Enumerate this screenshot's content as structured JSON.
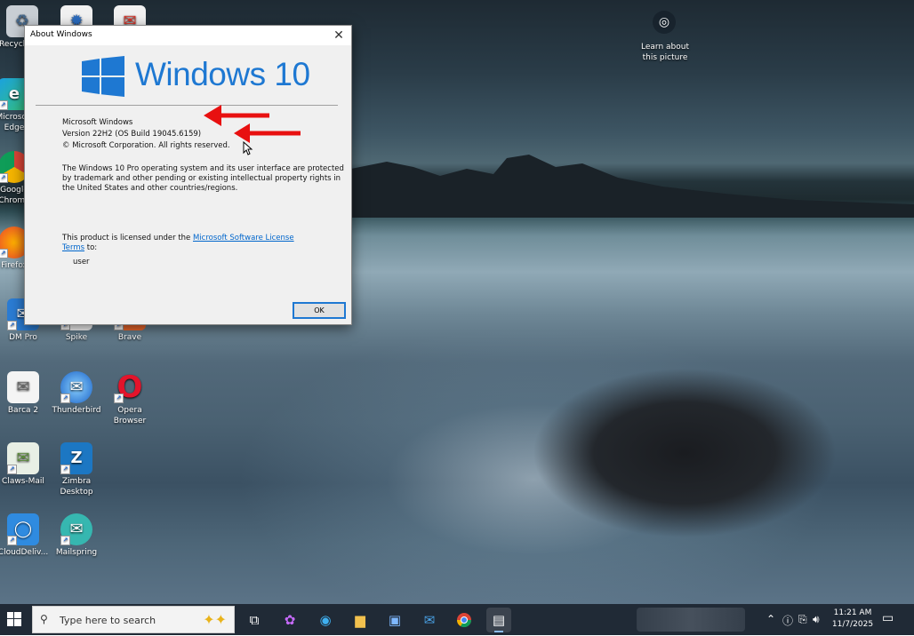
{
  "desktop": {
    "lens_label_1": "Learn about",
    "lens_label_2": "this picture",
    "icons": [
      {
        "label": "Recycle Bin",
        "icon": "recycle-bin-icon"
      },
      {
        "label": "Microsoft Edge",
        "icon": "edge-icon"
      },
      {
        "label": "Google Chrome",
        "icon": "chrome-icon"
      },
      {
        "label": "Firefox",
        "icon": "firefox-icon"
      },
      {
        "label": "DM Pro",
        "icon": "dm-pro-icon"
      },
      {
        "label": "Spike",
        "icon": "spike-icon"
      },
      {
        "label": "Brave",
        "icon": "brave-icon"
      },
      {
        "label": "Barca 2",
        "icon": "barca-icon"
      },
      {
        "label": "Thunderbird",
        "icon": "thunderbird-icon"
      },
      {
        "label": "Opera Browser",
        "icon": "opera-icon"
      },
      {
        "label": "Claws-Mail",
        "icon": "claws-mail-icon"
      },
      {
        "label": "Zimbra Desktop",
        "icon": "zimbra-icon"
      },
      {
        "label": "CloudDeliv...",
        "icon": "clouddelivery-icon"
      },
      {
        "label": "Mailspring",
        "icon": "mailspring-icon"
      }
    ]
  },
  "dialog": {
    "title": "About Windows",
    "logo_text": "Windows 10",
    "product": "Microsoft Windows",
    "version": "Version 22H2 (OS Build 19045.6159)",
    "copyright": "© Microsoft Corporation. All rights reserved.",
    "desc_1": "The Windows 10 Pro operating system and its user interface are protected",
    "desc_2": "by trademark and other pending or existing intellectual property rights in",
    "desc_3": "the United States and other countries/regions.",
    "license_prefix": "This product is licensed under the ",
    "license_link_1": "Microsoft Software License",
    "license_link_2": "Terms",
    "license_suffix": " to:",
    "user": "user",
    "ok_label": "OK"
  },
  "taskbar": {
    "search_placeholder": "Type here to search",
    "time": "11:21 AM",
    "date": "11/7/2025"
  },
  "colors": {
    "accent": "#1e78d2",
    "annotation_arrow": "#e81010",
    "taskbar_bg": "#202a36"
  }
}
